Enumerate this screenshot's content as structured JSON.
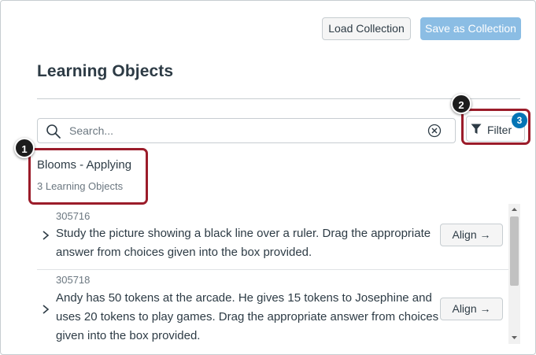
{
  "toolbar": {
    "load_label": "Load Collection",
    "save_label": "Save as Collection"
  },
  "page": {
    "title": "Learning Objects"
  },
  "search": {
    "placeholder": "Search...",
    "value": "",
    "icon": "search-icon",
    "clear_icon": "clear-icon"
  },
  "filter": {
    "label": "Filter",
    "count": "3",
    "icon": "filter-icon"
  },
  "callouts": [
    "1",
    "2"
  ],
  "group": {
    "title": "Blooms - Applying",
    "count_text": "3 Learning Objects"
  },
  "items": [
    {
      "id": "305716",
      "text": "Study the picture showing a black line over a ruler. Drag the appropriate answer from choices given into the box provided.",
      "align_label": "Align →"
    },
    {
      "id": "305718",
      "text": "Andy has 50 tokens at the arcade. He gives 15 tokens to Josephine and uses 20 tokens to play games. Drag the appropriate answer from choices given into the box provided.",
      "align_label": "Align →"
    }
  ],
  "colors": {
    "accent": "#0374b5",
    "save_button": "#8bbde4",
    "highlight": "#9b1c2a",
    "text": "#2d3b45",
    "muted": "#6b7780"
  }
}
